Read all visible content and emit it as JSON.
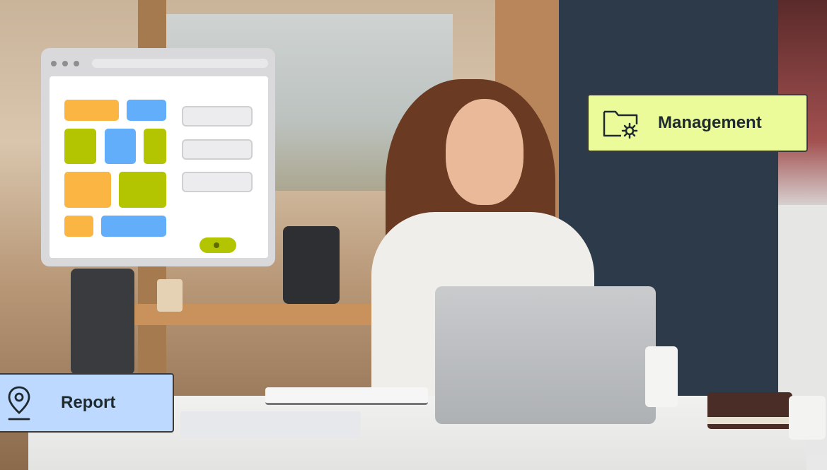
{
  "management_label": {
    "text": "Management",
    "icon": "folder-gear-icon",
    "background": "#ecfb9a"
  },
  "report_label": {
    "text": "Report",
    "icon": "location-pin-icon",
    "background": "#bed9ff"
  },
  "illustration": {
    "icon": "browser-map-icon",
    "colors": {
      "orange": "#fbb543",
      "blue": "#62aefa",
      "green": "#b2c500",
      "pin": "#e8262e"
    }
  }
}
